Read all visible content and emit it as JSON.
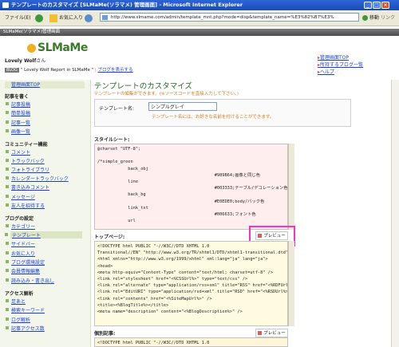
{
  "window": {
    "title": "テンプレートのカスタマイズ [SLMaMe(ソラマメ) 管理画面] - Microsoft Internet Explorer",
    "min": "_",
    "max": "□",
    "close": "×"
  },
  "toolbar": {
    "file": "ファイル(E)",
    "favorites": "お気に入り",
    "go": "移動",
    "links": "リンク"
  },
  "address": {
    "url": "http://www.slmame.com/admin/template_mnt.php?mode=disp&template_name=%E3%82%B7%E3%"
  },
  "appstrip": {
    "label": "SLMaMe(ソラマメ)管理画面"
  },
  "header": {
    "logo": "SLMaMe",
    "user_name": "Lovely Wolf",
    "user_suffix": "さん",
    "blog_badge": "BLOG",
    "blog_title": "\" Lovely Wolf Report in SLMaMe \"",
    "blog_link": "ブログを表示する",
    "right_links": [
      "管理画面TOP",
      "所持するブログ一覧",
      "ヘルプ"
    ]
  },
  "sidebar": {
    "top": "管理画面TOP",
    "sections": [
      {
        "title": "記事を書く",
        "items": [
          "記事投稿",
          "簡単投稿",
          "記事一覧",
          "画像一覧"
        ]
      },
      {
        "title": "コミュニティー機能",
        "items": [
          "コメント",
          "トラックバック",
          "フォトライブラリ",
          "カレンダートラックバック",
          "書き込みコメント",
          "メッセージ",
          "友人を招待する"
        ]
      },
      {
        "title": "ブログの設定",
        "items": [
          "カテゴリー",
          "テンプレート",
          "サイドバー",
          "お気に入り",
          "ブログ環境設定",
          "会員情報編集",
          "読み込み・書き出し"
        ]
      },
      {
        "title": "アクセス解析",
        "items": [
          "足あと",
          "検索キーワード",
          "ログ解析",
          "記事アクセス数"
        ]
      }
    ],
    "selected": "テンプレート"
  },
  "main": {
    "title": "テンプレートのカスタマイズ",
    "subtitle": "テンプレートの編集ができます。(※ソースコードを直接入力して下さい。)",
    "template_name_label": "テンプレート名:",
    "template_name_value": "シンプルグレイ",
    "template_name_note": "テンプレート名には、お好きな名前を付けることができます。",
    "stylesheet_label": "スタイルシート:",
    "stylesheet_code": "@charset \"UTF-8\";\n\n/*simple_green\n            back_obj\n                                              #989B64;画像と同じ色\n            line\n                                              #003333;テーブル/デコレーション色\n            back_bg\n                                              #E0EDE0;body/バック色\n            link_txt\n                                              #006633;フォント色\n            url",
    "toppage_label": "トップページ:",
    "preview_label": "プレビュー",
    "toppage_code": "<!DOCTYPE html PUBLIC \"-//W3C//DTD XHTML 1.0\nTransitional//EN\" \"http://www.w3.org/TR/xhtml1/DTD/xhtml1-transitional.dtd\">\n<html xmlns=\"http://www.w3.org/1999/xhtml\" xml:lang=\"ja\" lang=\"ja\">\n<head>\n<meta http-equiv=\"Content-Type\" content=\"text/html; charset=utf-8\" />\n<link rel=\"stylesheet\" href=\"<%CSSUrl%>\" type=\"text/css\" />\n<link rel=\"alternate\" type=\"application/rss+xml\" title=\"RSS\" href=\"<%RDFUrl%>\" />\n<link rel=\"EditURI\" type=\"application/rsd+xml\" title=\"RSD\" href=\"<%RSDUrl%>\" />\n<link rel=\"contents\" href=\"<%SiteMapUrl%>\" />\n<title><%BlogTitle%></title>\n<meta name=\"description\" content=\"<%BlogDescription%>\" />",
    "entry_label": "個別記事:",
    "entry_code": "<!DOCTYPE html PUBLIC \"-//W3C//DTD XHTML 1.0"
  }
}
